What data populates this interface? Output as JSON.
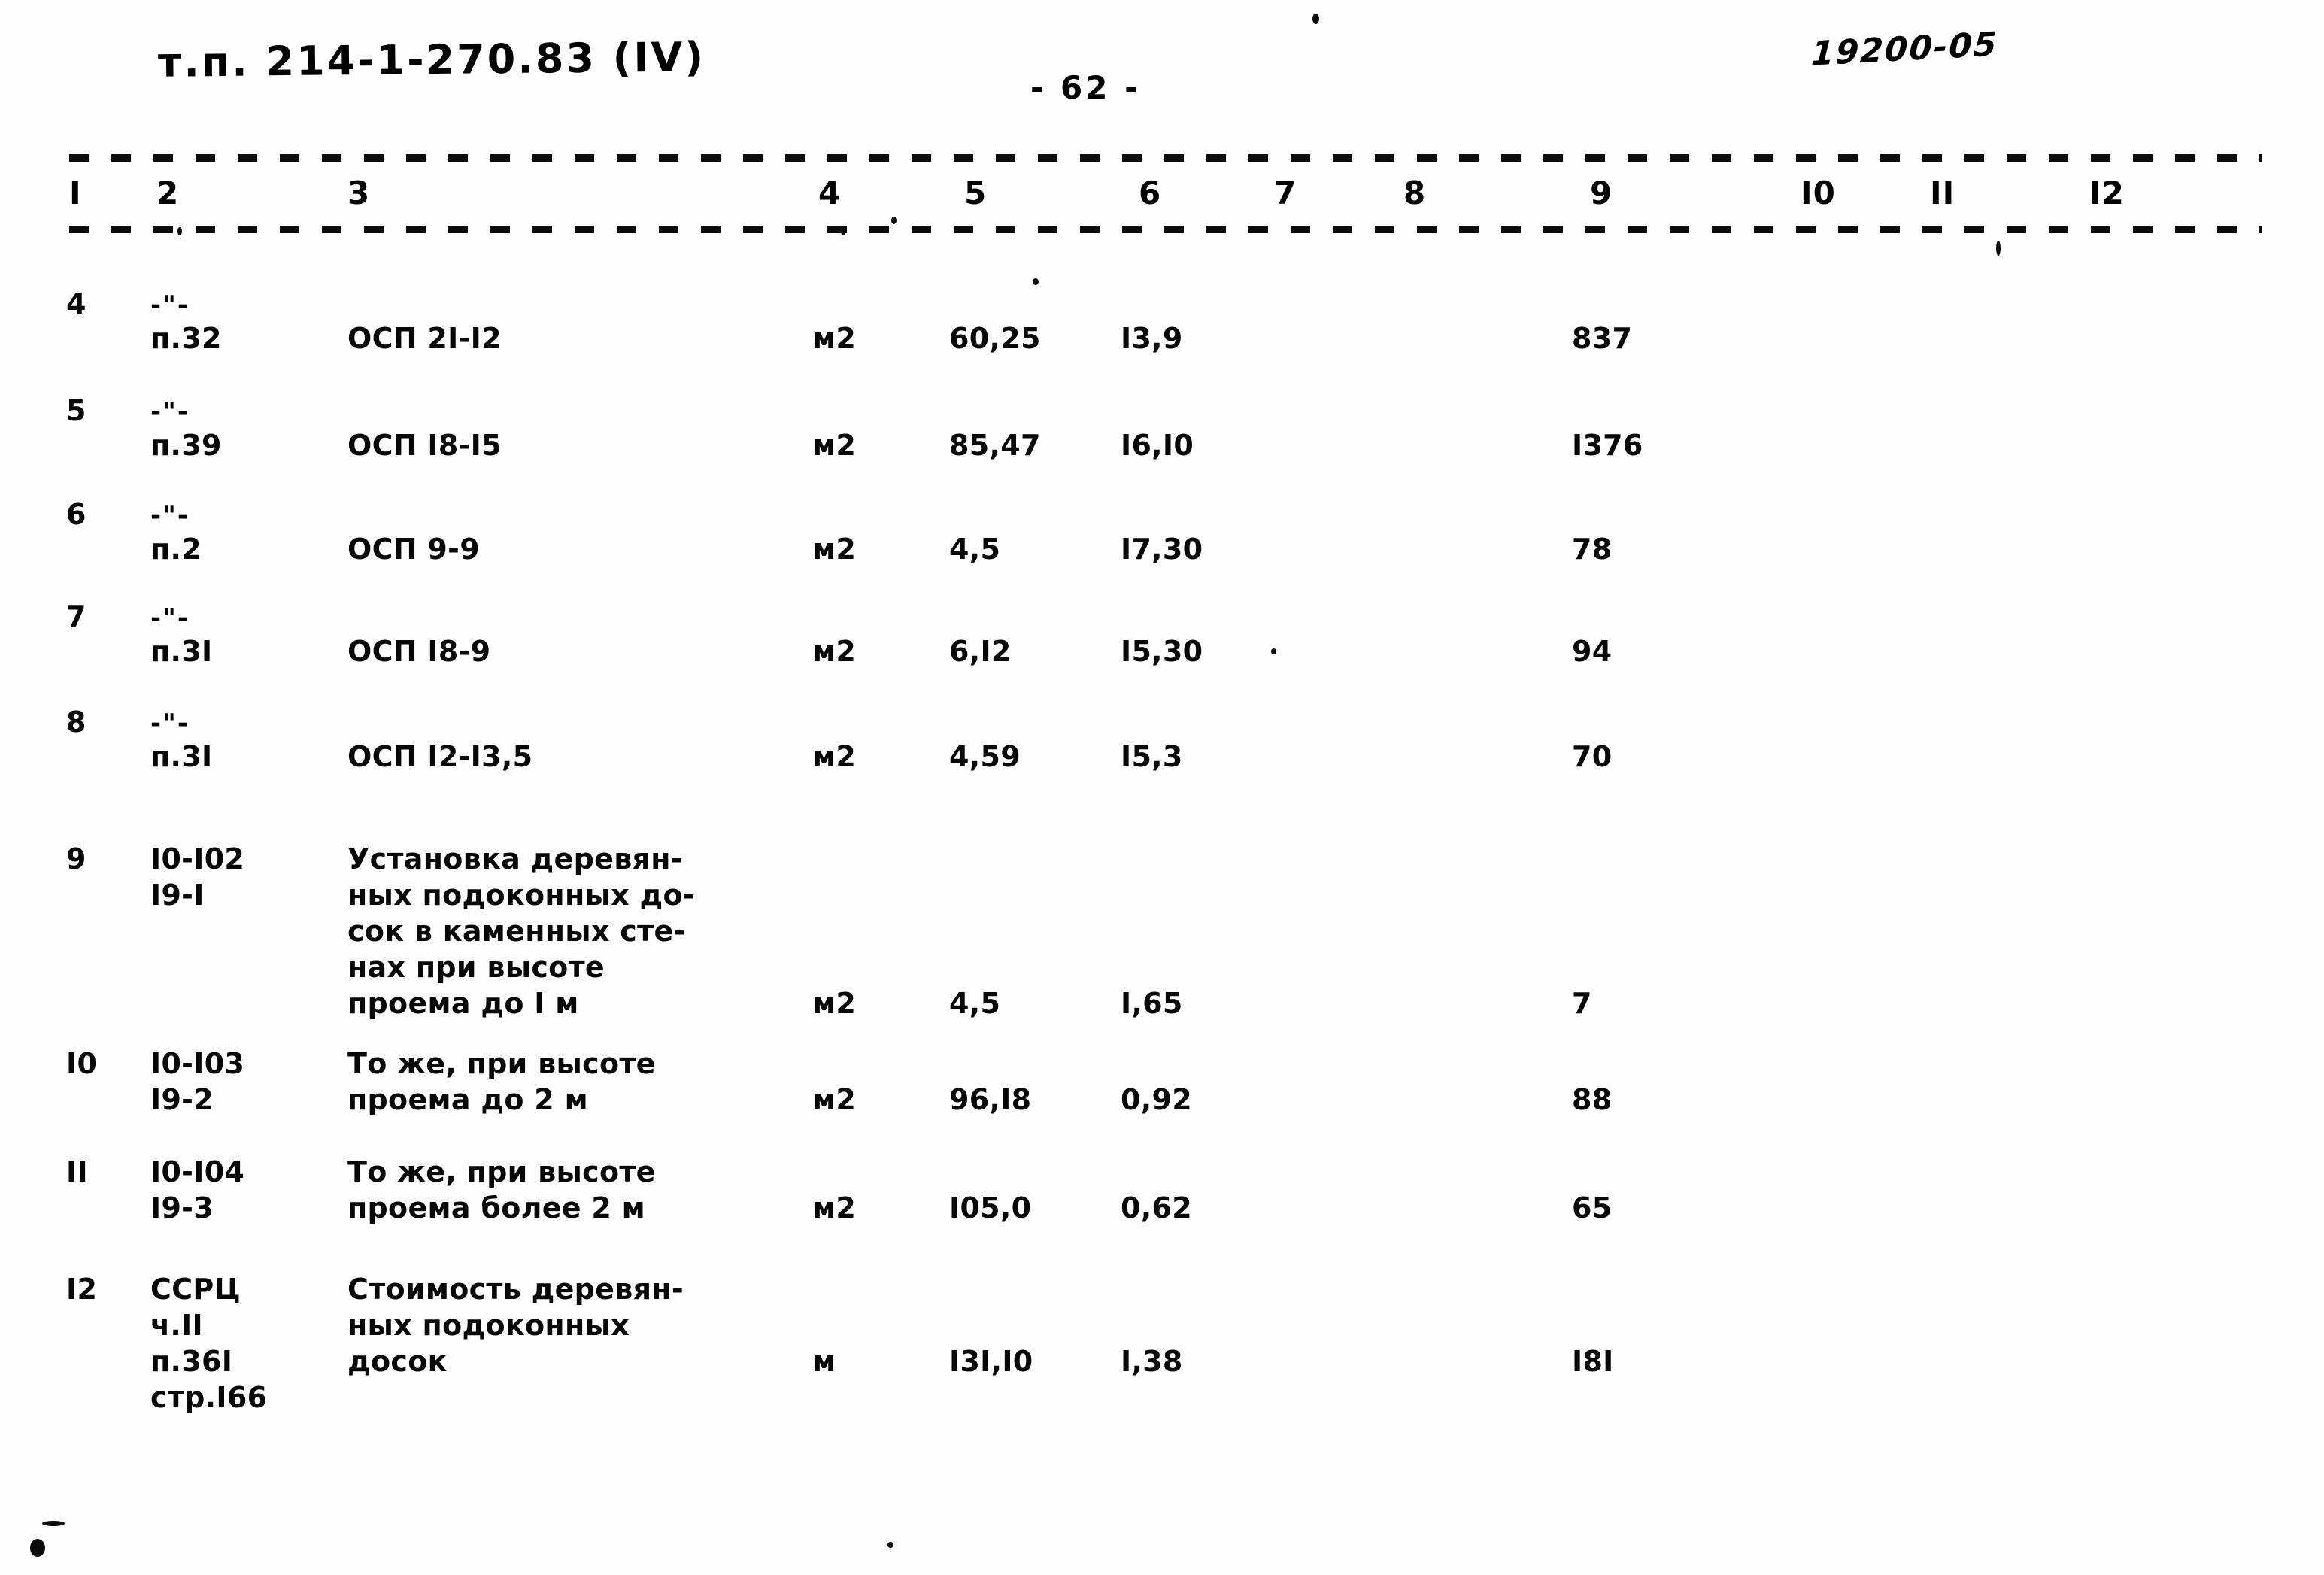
{
  "header": {
    "doc_code": "т.п. 214-1-270.83 (IV)",
    "page_number": "- 62 -",
    "archive_code": "19200-05"
  },
  "table": {
    "column_headers": [
      "I",
      "2",
      "3",
      "4",
      "5",
      "6",
      "7",
      "8",
      "9",
      "I0",
      "II",
      "I2"
    ],
    "rows": [
      {
        "num": "4",
        "ditto": "-\"-",
        "ref": "п.32",
        "desc": "ОСП 2I-I2",
        "unit": "м2",
        "qty": "60,25",
        "price": "I3,9",
        "total": "837"
      },
      {
        "num": "5",
        "ditto": "-\"-",
        "ref": "п.39",
        "desc": "ОСП I8-I5",
        "unit": "м2",
        "qty": "85,47",
        "price": "I6,I0",
        "total": "I376"
      },
      {
        "num": "6",
        "ditto": "-\"-",
        "ref": "п.2",
        "desc": "ОСП 9-9",
        "unit": "м2",
        "qty": "4,5",
        "price": "I7,30",
        "total": "78"
      },
      {
        "num": "7",
        "ditto": "-\"-",
        "ref": "п.3I",
        "desc": "ОСП I8-9",
        "unit": "м2",
        "qty": "6,I2",
        "price": "I5,30",
        "total": "94"
      },
      {
        "num": "8",
        "ditto": "-\"-",
        "ref": "п.3I",
        "desc": "ОСП I2-I3,5",
        "unit": "м2",
        "qty": "4,59",
        "price": "I5,3",
        "total": "70"
      },
      {
        "num": "9",
        "ditto": "",
        "ref": "I0-I02\nI9-I",
        "desc": "Установка деревян-\nных подоконных до-\nсок в каменных сте-\nнах при высоте\nпроема до I м",
        "unit": "м2",
        "qty": "4,5",
        "price": "I,65",
        "total": "7"
      },
      {
        "num": "I0",
        "ditto": "",
        "ref": "I0-I03\nI9-2",
        "desc": "То же, при высоте\nпроема до 2 м",
        "unit": "м2",
        "qty": "96,I8",
        "price": "0,92",
        "total": "88"
      },
      {
        "num": "II",
        "ditto": "",
        "ref": "I0-I04\nI9-3",
        "desc": "То же, при высоте\nпроема более 2 м",
        "unit": "м2",
        "qty": "I05,0",
        "price": "0,62",
        "total": "65"
      },
      {
        "num": "I2",
        "ditto": "",
        "ref": "ССРЦ\nч.II\nп.36I\nстр.I66",
        "desc": "Стоимость деревян-\nных подоконных\nдосок",
        "unit": "м",
        "qty": "I3I,I0",
        "price": "I,38",
        "total": "I8I"
      }
    ]
  }
}
